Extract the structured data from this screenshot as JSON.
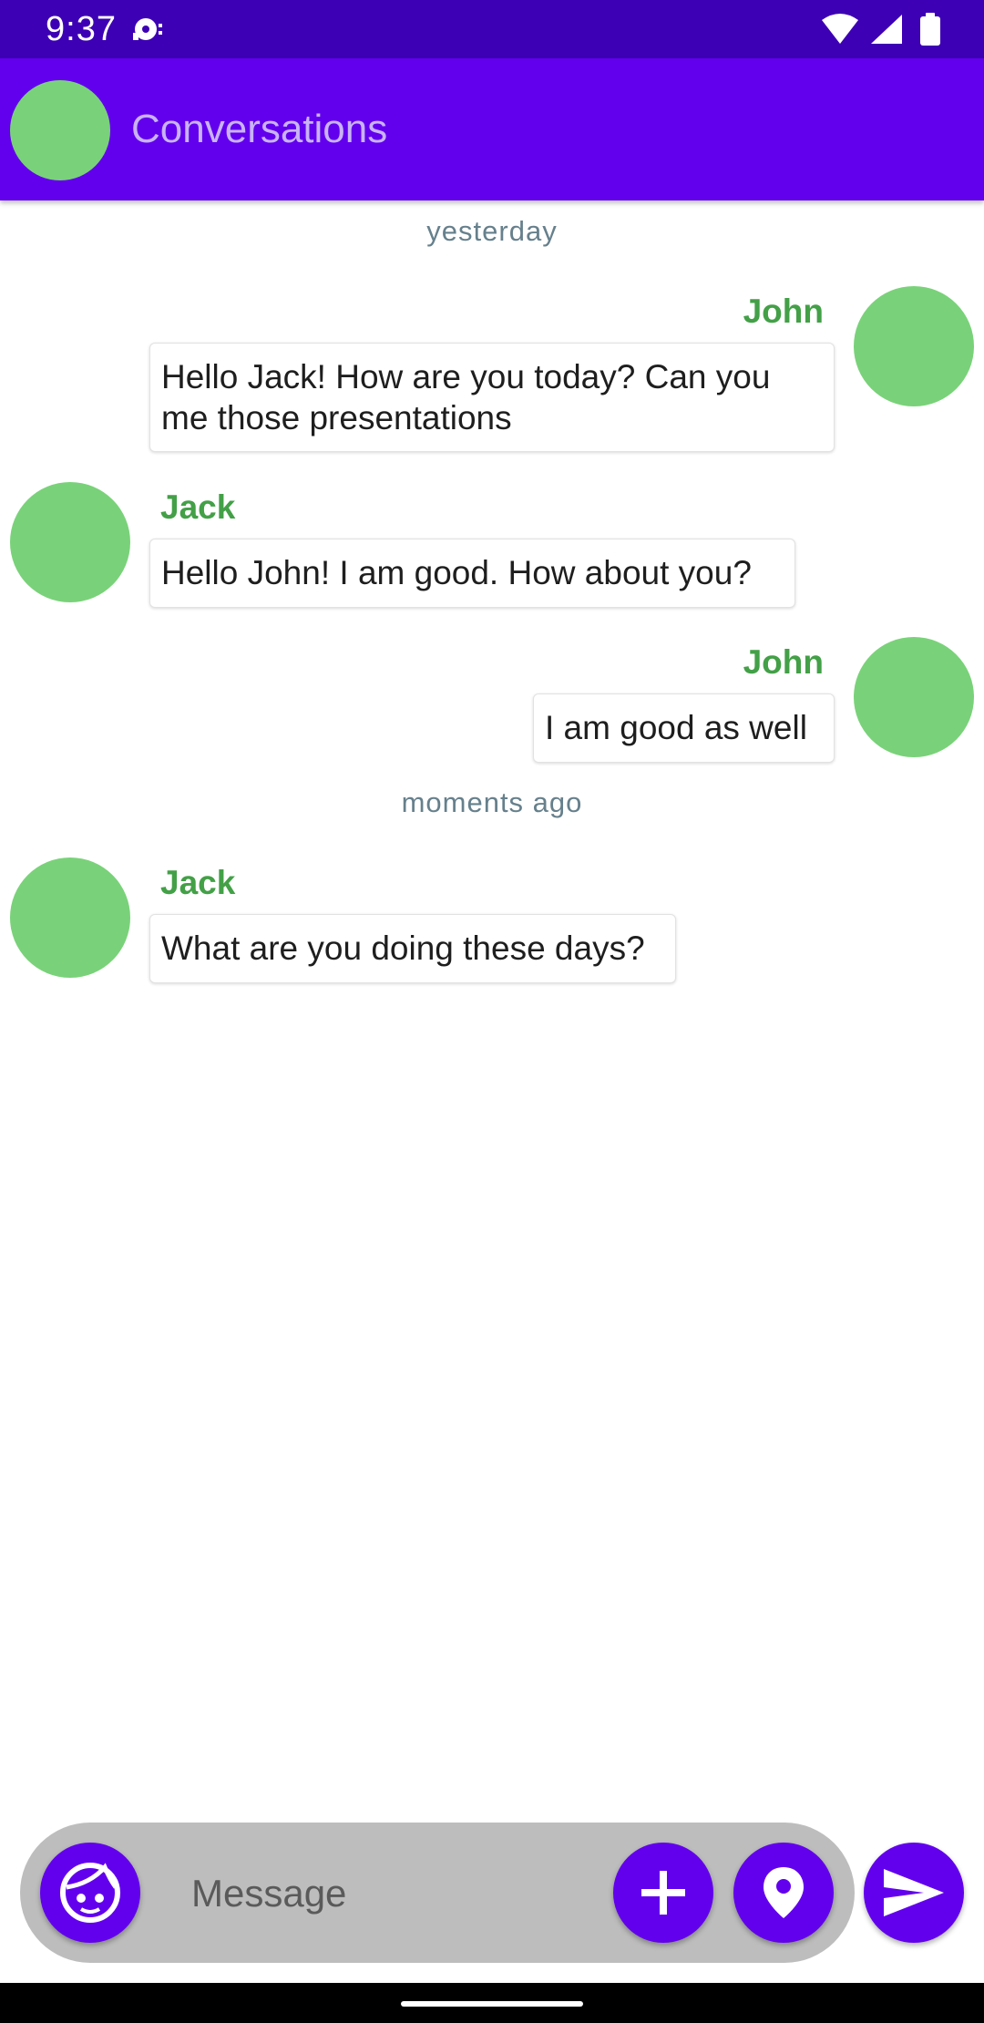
{
  "status_bar": {
    "time": "9:37",
    "icons": [
      "media-notification-icon",
      "wifi-icon",
      "cell-signal-icon",
      "battery-icon"
    ]
  },
  "app_bar": {
    "title": "Conversations",
    "avatar_color": "#79d279",
    "background": "#6200ee"
  },
  "conversation": {
    "separators": [
      "yesterday",
      "moments ago"
    ],
    "messages": [
      {
        "sender": "John",
        "text": "Hello Jack! How are you today? Can you me those presentations",
        "side": "right"
      },
      {
        "sender": "Jack",
        "text": "Hello John! I am good. How about you?",
        "side": "left"
      },
      {
        "sender": "John",
        "text": "I am good as well",
        "side": "right"
      },
      {
        "sender": "Jack",
        "text": "What are you doing these days?",
        "side": "left"
      }
    ]
  },
  "composer": {
    "placeholder": "Message",
    "value": "",
    "buttons": [
      "emoji-face-icon",
      "add-icon",
      "location-icon",
      "send-icon"
    ]
  },
  "colors": {
    "accent": "#6200ee",
    "status_bar": "#3d00b4",
    "sender_name": "#43a047",
    "avatar": "#79d279",
    "separator_text": "#66808c",
    "composer_background": "#bdbdbd"
  }
}
